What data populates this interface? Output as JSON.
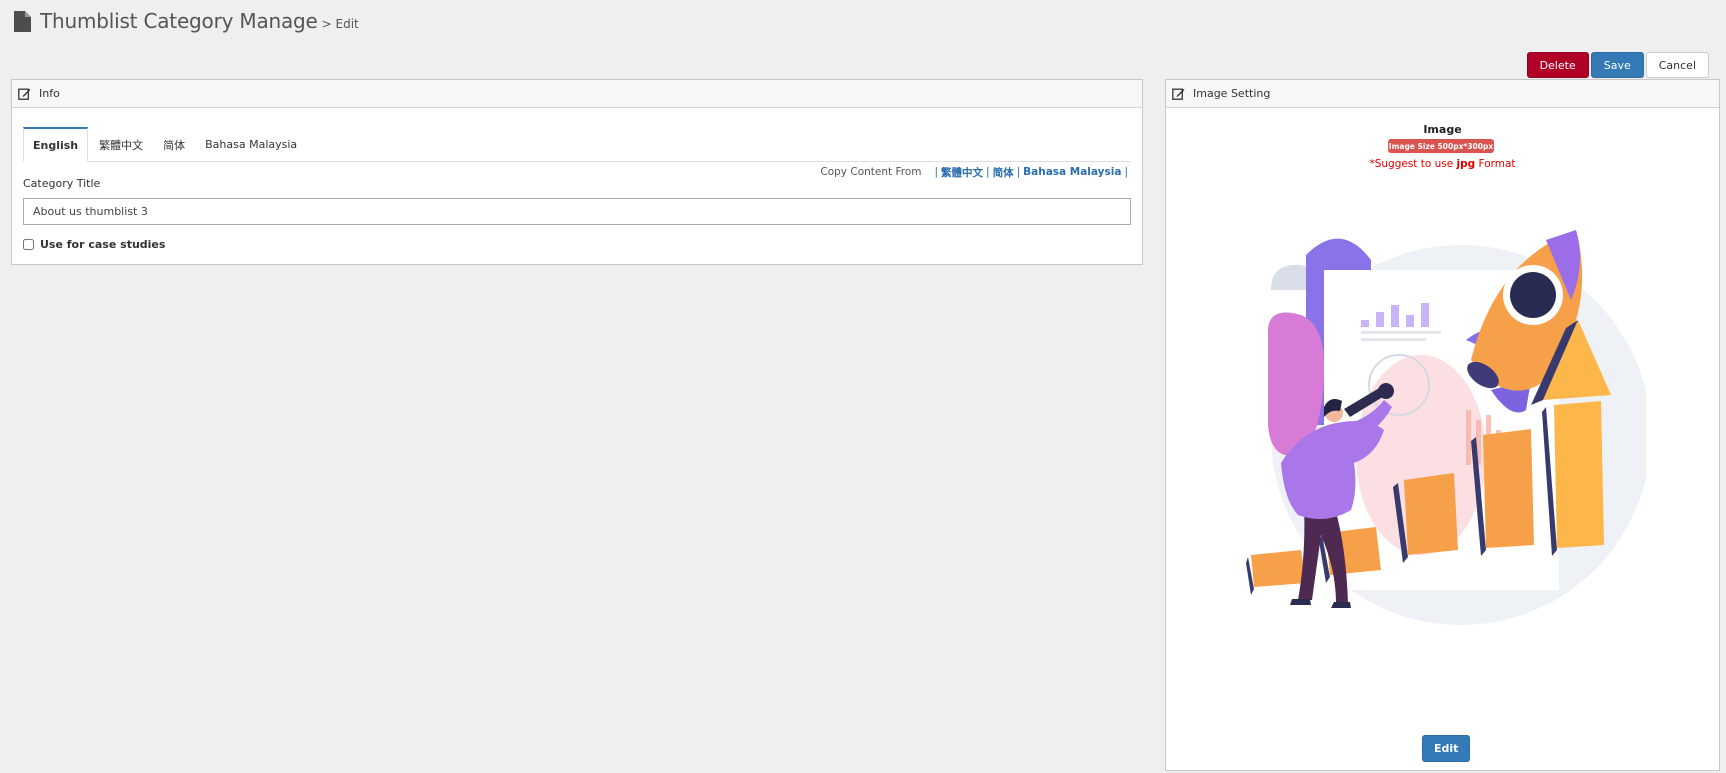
{
  "header": {
    "title": "Thumblist Category Manage",
    "breadcrumb": "> Edit",
    "icon": "document-icon"
  },
  "toolbar": {
    "delete_label": "Delete",
    "save_label": "Save",
    "cancel_label": "Cancel"
  },
  "info_panel": {
    "title": "Info",
    "icon": "edit-icon",
    "tabs": [
      {
        "label": "English",
        "active": true
      },
      {
        "label": "繁體中文",
        "active": false
      },
      {
        "label": "简体",
        "active": false
      },
      {
        "label": "Bahasa Malaysia",
        "active": false
      }
    ],
    "copy_content": {
      "label": "Copy Content From",
      "links": [
        "繁體中文",
        "简体",
        "Bahasa Malaysia"
      ]
    },
    "category_title": {
      "label": "Category Title",
      "value": "About us thumblist 3"
    },
    "case_studies": {
      "label": "Use for case studies",
      "checked": false
    }
  },
  "image_panel": {
    "title": "Image Setting",
    "icon": "edit-icon",
    "image_label": "Image",
    "size_badge": "Image Size 500px*300px",
    "suggest_prefix": "*Suggest to use ",
    "suggest_format": "jpg",
    "suggest_suffix": " Format",
    "edit_label": "Edit"
  },
  "colors": {
    "danger": "#b10025",
    "primary": "#337ab7",
    "badge": "#d9534f",
    "warning_text": "#e00000"
  }
}
